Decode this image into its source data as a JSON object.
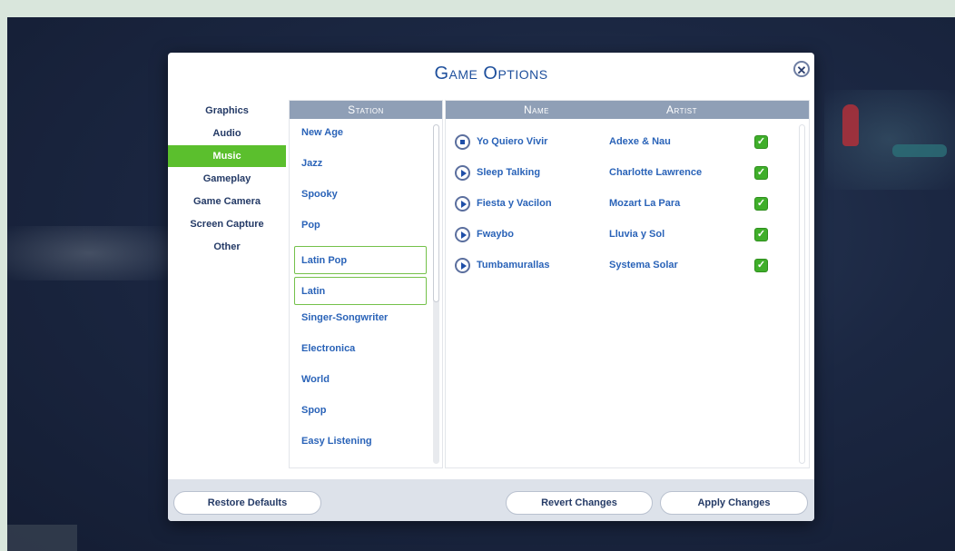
{
  "dialog": {
    "title": "Game Options",
    "close_icon": "close-icon"
  },
  "nav": {
    "items": [
      {
        "label": "Graphics",
        "active": false
      },
      {
        "label": "Audio",
        "active": false
      },
      {
        "label": "Music",
        "active": true
      },
      {
        "label": "Gameplay",
        "active": false
      },
      {
        "label": "Game Camera",
        "active": false
      },
      {
        "label": "Screen Capture",
        "active": false
      },
      {
        "label": "Other",
        "active": false
      }
    ]
  },
  "stations": {
    "header": "Station",
    "items": [
      {
        "label": "New Age",
        "selected": false
      },
      {
        "label": "Jazz",
        "selected": false
      },
      {
        "label": "Spooky",
        "selected": false
      },
      {
        "label": "Pop",
        "selected": false
      },
      {
        "label": "Latin Pop",
        "selected": true
      },
      {
        "label": "Latin",
        "selected": true
      },
      {
        "label": "Singer-Songwriter",
        "selected": false
      },
      {
        "label": "Electronica",
        "selected": false
      },
      {
        "label": "World",
        "selected": false
      },
      {
        "label": "Spop",
        "selected": false
      },
      {
        "label": "Easy Listening",
        "selected": false
      }
    ]
  },
  "songs": {
    "header_name": "Name",
    "header_artist": "Artist",
    "rows": [
      {
        "name": "Yo Quiero Vivir",
        "artist": "Adexe & Nau",
        "state": "stop-icon",
        "enabled": true
      },
      {
        "name": "Sleep Talking",
        "artist": "Charlotte Lawrence",
        "state": "play-icon",
        "enabled": true
      },
      {
        "name": "Fiesta y Vacilon",
        "artist": "Mozart La Para",
        "state": "play-icon",
        "enabled": true
      },
      {
        "name": "Fwaybo",
        "artist": "Lluvia y Sol",
        "state": "play-icon",
        "enabled": true
      },
      {
        "name": "Tumbamurallas",
        "artist": "Systema Solar",
        "state": "play-icon",
        "enabled": true
      }
    ]
  },
  "footer": {
    "restore_label": "Restore Defaults",
    "revert_label": "Revert Changes",
    "apply_label": "Apply Changes"
  },
  "colors": {
    "accent_green": "#5bbf2d",
    "title_blue": "#1e4f9c",
    "header_gray": "#8f9fb6",
    "text_blue": "#2a63b8"
  }
}
